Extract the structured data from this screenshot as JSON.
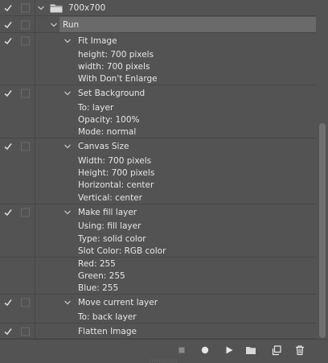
{
  "actions": {
    "set_name": "700x700",
    "action_name": "Run",
    "steps": [
      {
        "name": "Fit Image",
        "params": [
          "height: 700 pixels",
          "width: 700 pixels",
          "With Don't Enlarge"
        ]
      },
      {
        "name": "Set Background",
        "params": [
          "To: layer",
          "Opacity: 100%",
          "Mode: normal"
        ]
      },
      {
        "name": "Canvas Size",
        "params": [
          "Width: 700 pixels",
          "Height: 700 pixels",
          "Horizontal: center",
          "Vertical: center"
        ]
      },
      {
        "name": "Make fill layer",
        "params": [
          "Using: fill layer",
          "Type: solid color",
          "Slot Color: RGB color",
          "Red: 255",
          "Green: 255",
          "Blue: 255"
        ]
      },
      {
        "name": "Move current layer",
        "params": [
          "To: back layer"
        ]
      },
      {
        "name": "Flatten Image",
        "params": []
      }
    ]
  },
  "toolbar": {
    "icons": [
      "stop-icon",
      "record-icon",
      "play-icon",
      "folder-icon",
      "new-action-icon",
      "trash-icon"
    ]
  },
  "colors": {
    "panel_bg": "#535353",
    "highlight": "#6a6a6a",
    "text": "#e6e6e6",
    "scrollbar_thumb": "#6f6f6f"
  }
}
